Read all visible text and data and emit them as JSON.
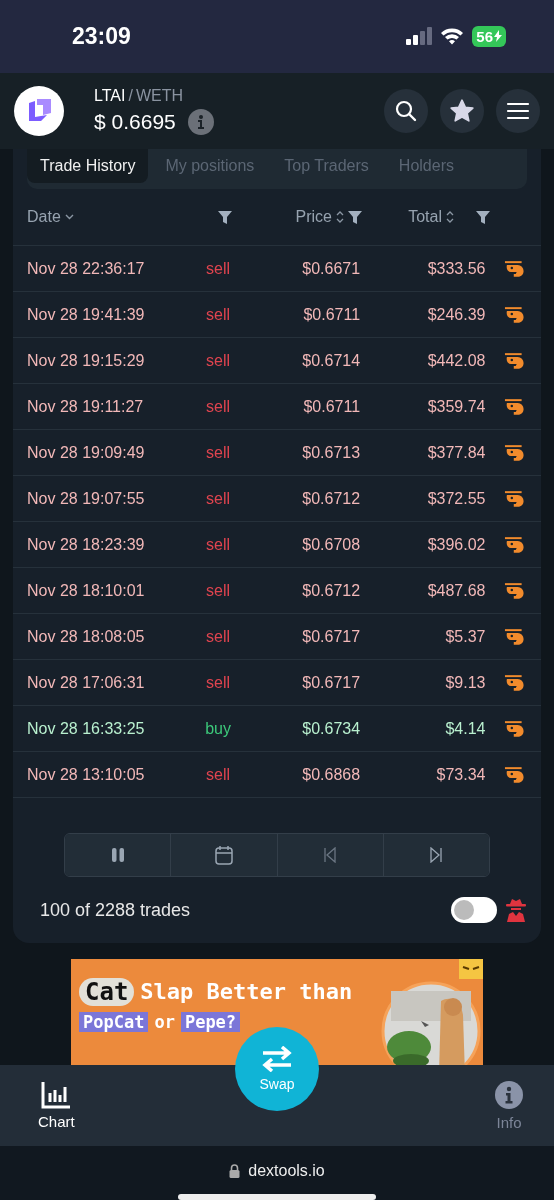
{
  "status_bar": {
    "time": "23:09",
    "battery": "56"
  },
  "header": {
    "base": "LTAI",
    "separator": "/",
    "quote": "WETH",
    "price": "$ 0.6695"
  },
  "tabs": [
    {
      "label": "Trade History",
      "selected": true
    },
    {
      "label": "My positions",
      "selected": false
    },
    {
      "label": "Top Traders",
      "selected": false
    },
    {
      "label": "Holders",
      "selected": false
    }
  ],
  "table": {
    "columns": [
      "Date",
      "Price",
      "Total"
    ],
    "rows": [
      {
        "date": "Nov 28 22:36:17",
        "side": "sell",
        "kind": "sell",
        "price": "$0.6671",
        "total": "$333.56"
      },
      {
        "date": "Nov 28 19:41:39",
        "side": "sell",
        "kind": "sell",
        "price": "$0.6711",
        "total": "$246.39"
      },
      {
        "date": "Nov 28 19:15:29",
        "side": "sell",
        "kind": "sell",
        "price": "$0.6714",
        "total": "$442.08"
      },
      {
        "date": "Nov 28 19:11:27",
        "side": "sell",
        "kind": "sell",
        "price": "$0.6711",
        "total": "$359.74"
      },
      {
        "date": "Nov 28 19:09:49",
        "side": "sell",
        "kind": "sell",
        "price": "$0.6713",
        "total": "$377.84"
      },
      {
        "date": "Nov 28 19:07:55",
        "side": "sell",
        "kind": "sell",
        "price": "$0.6712",
        "total": "$372.55"
      },
      {
        "date": "Nov 28 18:23:39",
        "side": "sell",
        "kind": "sell",
        "price": "$0.6708",
        "total": "$396.02"
      },
      {
        "date": "Nov 28 18:10:01",
        "side": "sell",
        "kind": "sell",
        "price": "$0.6712",
        "total": "$487.68"
      },
      {
        "date": "Nov 28 18:08:05",
        "side": "sell",
        "kind": "sell",
        "price": "$0.6717",
        "total": "$5.37"
      },
      {
        "date": "Nov 28 17:06:31",
        "side": "sell",
        "kind": "sell",
        "price": "$0.6717",
        "total": "$9.13"
      },
      {
        "date": "Nov 28 16:33:25",
        "side": "buy",
        "kind": "buy",
        "price": "$0.6734",
        "total": "$4.14"
      },
      {
        "date": "Nov 28 13:10:05",
        "side": "sell",
        "kind": "sell",
        "price": "$0.6868",
        "total": "$73.34"
      }
    ]
  },
  "footer": {
    "count": "100 of 2288 trades",
    "toggle": {
      "on": false
    }
  },
  "ad": {
    "words": [
      {
        "text": "Cat",
        "kind": "pill"
      },
      {
        "text": "Slap Better than",
        "kind": "plain"
      },
      {
        "text": "PopCat",
        "kind": "mark"
      },
      {
        "text": "or",
        "kind": "plain"
      },
      {
        "text": "Pepe?",
        "kind": "mark"
      }
    ]
  },
  "nav": [
    {
      "label": "Chart",
      "kind": "chart"
    },
    {
      "label": "Swap",
      "kind": "swap"
    },
    {
      "label": "Info",
      "kind": "info"
    }
  ],
  "url_bar": {
    "domain": "dextools.io"
  }
}
